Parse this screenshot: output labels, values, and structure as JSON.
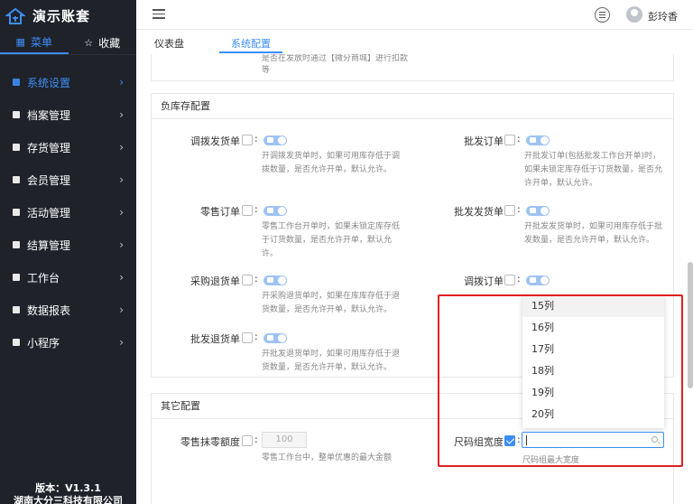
{
  "app": {
    "title": "演示账套"
  },
  "sidebar_tabs": [
    {
      "label": "菜单",
      "icon": "grid-icon"
    },
    {
      "label": "收藏",
      "icon": "star-icon"
    }
  ],
  "menu": [
    {
      "label": "系统设置",
      "active": true
    },
    {
      "label": "档案管理"
    },
    {
      "label": "存货管理"
    },
    {
      "label": "会员管理"
    },
    {
      "label": "活动管理"
    },
    {
      "label": "结算管理"
    },
    {
      "label": "工作台"
    },
    {
      "label": "数据报表"
    },
    {
      "label": "小程序"
    }
  ],
  "footer": {
    "version": "版本：V1.3.1",
    "company": "湖南大分三科技有限公司"
  },
  "topbar": {
    "username": "彭玲香"
  },
  "page_tabs": [
    {
      "label": "仪表盘"
    },
    {
      "label": "系统配置",
      "active": true
    }
  ],
  "top_fragment": {
    "line1": "是否在发放时通过【微分商城】进行扣款",
    "line2": "等"
  },
  "negative_stock": {
    "title": "负库存配置",
    "fields": [
      {
        "label": "调拨发货单",
        "desc": "开调拨发货单时，如果可用库存低于调拨数量，是否允许开单，默认允许。"
      },
      {
        "label": "批发订单",
        "desc": "开批发订单(包括批发工作台开单)时，如果未锁定库存低于订货数量，是否允许开单，默认允许。"
      },
      {
        "label": "零售订单",
        "desc": "零售工作台开单时，如果未锁定库存低于订货数量，是否允许开单，默认允许。"
      },
      {
        "label": "批发发货单",
        "desc": "开批发发货单时，如果可用库存低于批发数量，是否允许开单，默认允许。"
      },
      {
        "label": "采购退货单",
        "desc": "开采购退货单时，如果在库库存低于退货数量，是否允许开单，默认允许。"
      },
      {
        "label": "调拨订单",
        "desc": ""
      },
      {
        "label": "批发退货单",
        "desc": "开批发退货单时，如果可用库存低于退货数量，是否允许开单，默认允许。"
      }
    ]
  },
  "other": {
    "title": "其它配置",
    "rounding_label": "零售抹零额度",
    "rounding_value": "100",
    "rounding_desc": "零售工作台中，整单优惠的最大金额",
    "size_label": "尺码组宽度",
    "size_note": "尺码组最大宽度"
  },
  "dropdown": {
    "options": [
      "15列",
      "16列",
      "17列",
      "18列",
      "19列",
      "20列"
    ],
    "hover_index": 0,
    "value": ""
  }
}
